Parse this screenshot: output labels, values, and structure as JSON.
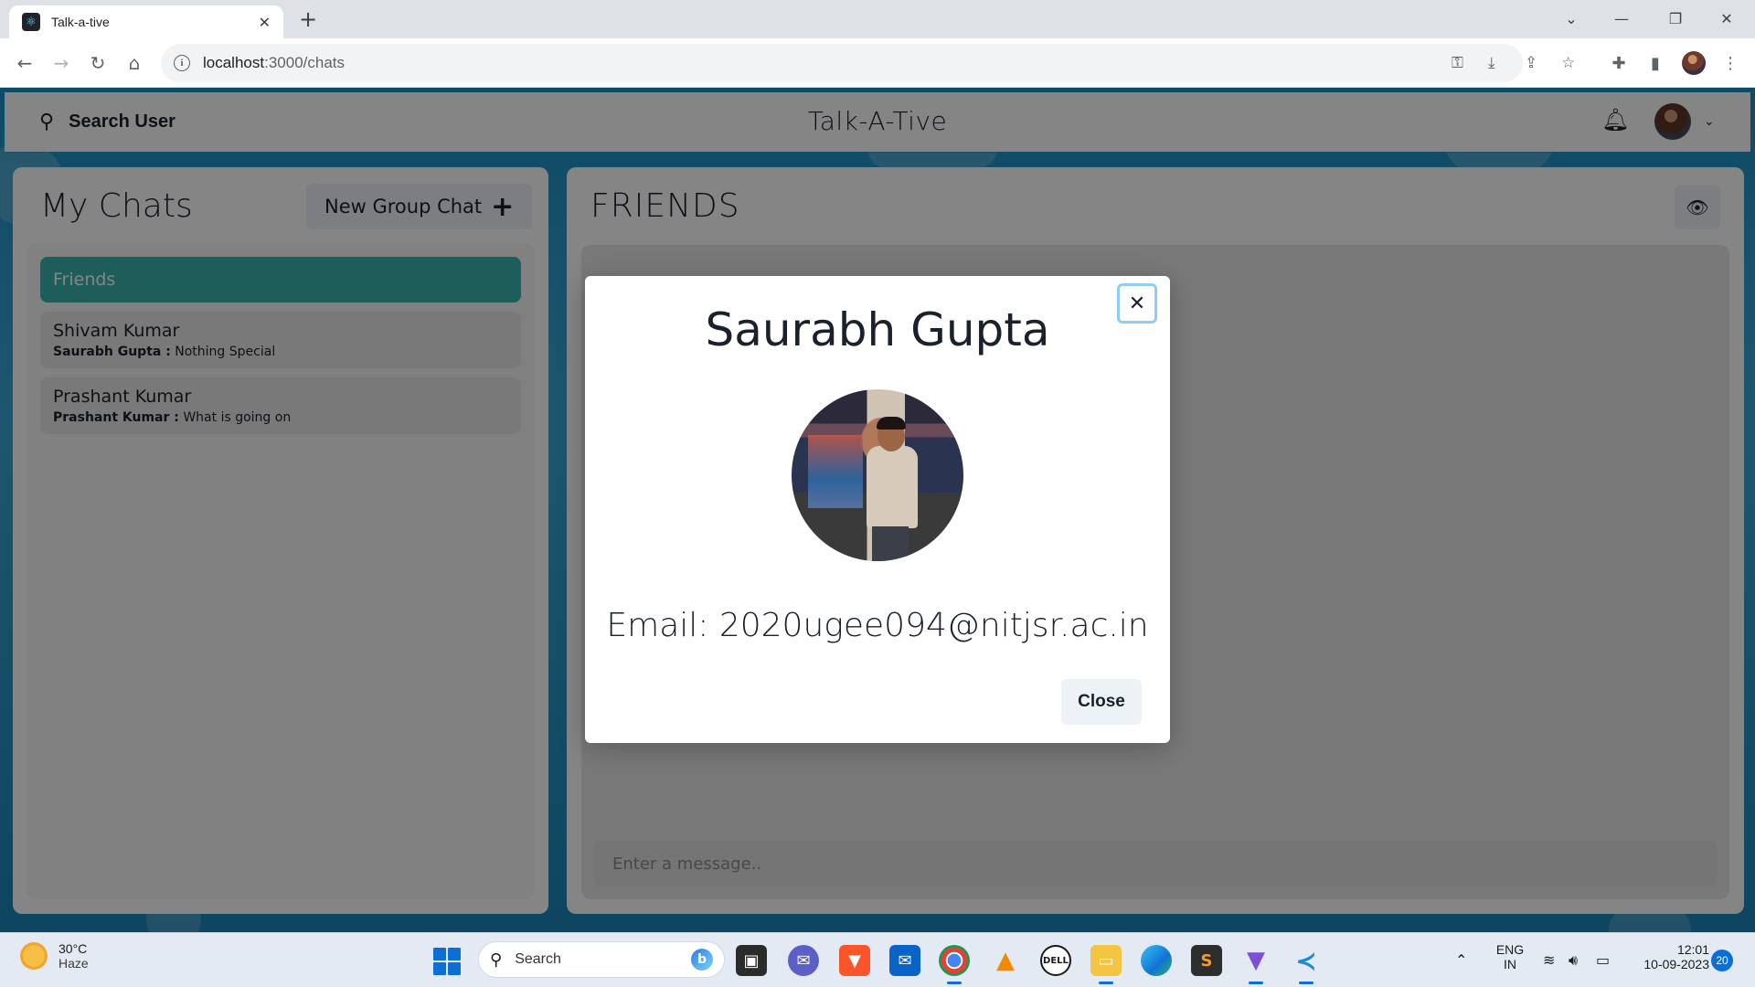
{
  "browser": {
    "tab_title": "Talk-a-tive",
    "url_host": "localhost",
    "url_path": ":3000/chats",
    "new_tab": "+",
    "close_tab": "✕"
  },
  "app": {
    "search_label": "Search User",
    "title": "Talk-A-Tive"
  },
  "my_chats": {
    "title": "My Chats",
    "new_group_label": "New Group Chat",
    "chats": [
      {
        "name": "Friends",
        "active": true
      },
      {
        "name": "Shivam Kumar",
        "sender": "Saurabh Gupta :",
        "message": "Nothing Special"
      },
      {
        "name": "Prashant Kumar",
        "sender": "Prashant Kumar :",
        "message": "What is going on"
      }
    ]
  },
  "chat_box": {
    "title": "FRIENDS",
    "input_placeholder": "Enter a message.."
  },
  "modal": {
    "name": "Saurabh Gupta",
    "email_text": "Email: 2020ugee094@nitjsr.ac.in",
    "close_label": "Close"
  },
  "taskbar": {
    "temperature": "30°C",
    "condition": "Haze",
    "search_label": "Search",
    "lang1": "ENG",
    "lang2": "IN",
    "time": "12:01",
    "date": "10-09-2023",
    "notifications": "20"
  },
  "colors": {
    "accent_teal": "#38b2ac",
    "background_blue": "#1d8fc4",
    "focus_ring": "#90cdf4"
  }
}
